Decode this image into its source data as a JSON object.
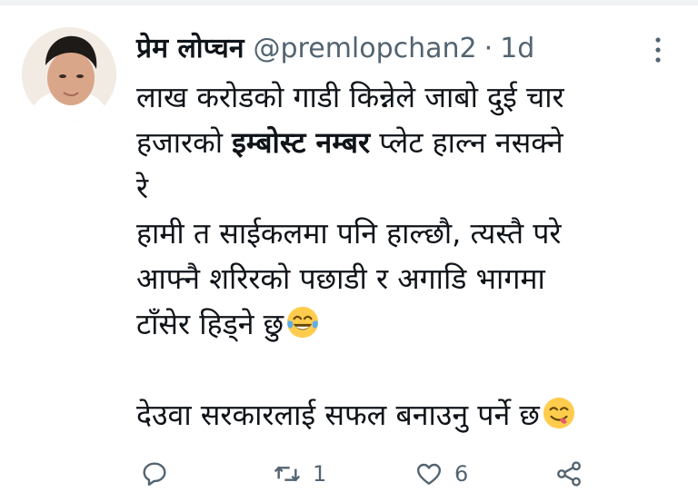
{
  "tweet": {
    "display_name": "प्रेम लोप्चन",
    "handle": "@premlopchan2",
    "separator": "·",
    "time": "1d",
    "lines": [
      {
        "parts": [
          {
            "text": "लाख करोडको गाडी किन्नेले जाबो दुई चार",
            "bold": false
          }
        ]
      },
      {
        "parts": [
          {
            "text": "हजारको ",
            "bold": false
          },
          {
            "text": "इम्बोस्ट नम्बर",
            "bold": true
          },
          {
            "text": " प्लेट हाल्न  नसक्ने",
            "bold": false
          }
        ]
      },
      {
        "parts": [
          {
            "text": "रे",
            "bold": false
          }
        ]
      },
      {
        "parts": [
          {
            "text": "हामी त साईकलमा पनि हाल्छौ, त्यस्तै परे",
            "bold": false
          }
        ]
      },
      {
        "parts": [
          {
            "text": "आफ्नै शरिरको पछाडी र अगाडि भागमा",
            "bold": false
          }
        ]
      },
      {
        "parts": [
          {
            "text": "टाँसेर हिड्ने छु",
            "bold": false
          }
        ],
        "emoji": "tears-of-joy-emoji"
      },
      {
        "parts": [],
        "blank": true
      },
      {
        "parts": [
          {
            "text": "देउवा सरकारलाई सफल बनाउनु पर्ने छ",
            "bold": false
          }
        ],
        "emoji": "yum-emoji"
      }
    ]
  },
  "actions": {
    "reply": {
      "icon": "reply-icon",
      "count": ""
    },
    "retweet": {
      "icon": "retweet-icon",
      "count": "1"
    },
    "like": {
      "icon": "heart-icon",
      "count": "6"
    },
    "share": {
      "icon": "share-icon",
      "count": ""
    }
  },
  "colors": {
    "text": "#0f1419",
    "secondary": "#536471",
    "border": "#eff3f4"
  }
}
